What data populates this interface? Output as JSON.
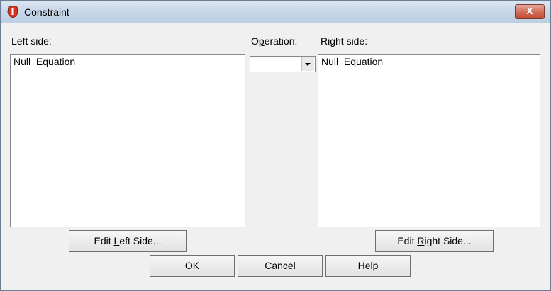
{
  "window": {
    "title": "Constraint",
    "close_glyph": "X"
  },
  "left": {
    "label": "Left side:",
    "items": [
      "Null_Equation"
    ]
  },
  "operation": {
    "label_pre": "O",
    "label_mn": "p",
    "label_post": "eration:",
    "value": ""
  },
  "right": {
    "label": "Right side:",
    "items": [
      "Null_Equation"
    ]
  },
  "buttons": {
    "edit_left": {
      "pre": "Edit ",
      "mn": "L",
      "post": "eft Side..."
    },
    "edit_right": {
      "pre": "Edit ",
      "mn": "R",
      "post": "ight Side..."
    },
    "ok": {
      "pre": "",
      "mn": "O",
      "post": "K"
    },
    "cancel": {
      "pre": "",
      "mn": "C",
      "post": "ancel"
    },
    "help": {
      "pre": "",
      "mn": "H",
      "post": "elp"
    }
  },
  "icons": {
    "app": "app-icon",
    "close": "close-icon",
    "dropdown": "chevron-down-icon"
  },
  "colors": {
    "title_bar": "#c9d8ea",
    "close_button": "#c9563d",
    "app_icon": "#d9341f"
  }
}
